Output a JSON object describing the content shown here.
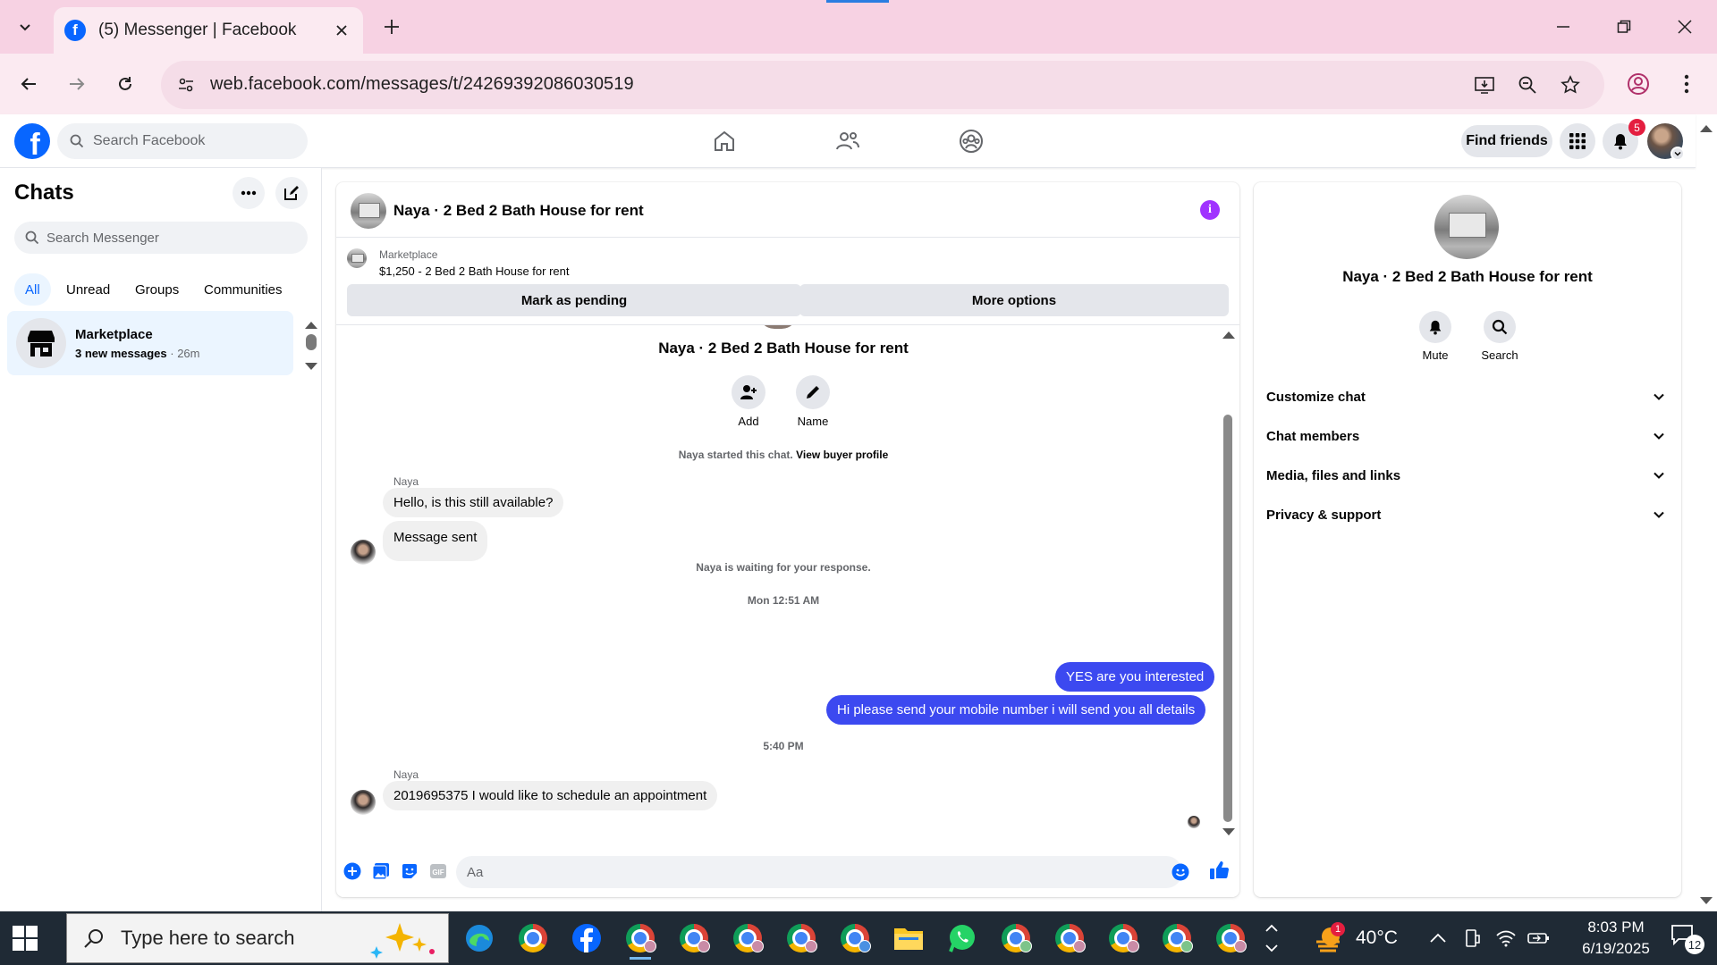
{
  "browser": {
    "tab_title": "(5) Messenger | Facebook",
    "favicon_letter": "f",
    "url": "web.facebook.com/messages/t/24269392086030519"
  },
  "fb_header": {
    "logo_letter": "f",
    "search_placeholder": "Search Facebook",
    "find_friends_label": "Find friends",
    "notification_count": "5"
  },
  "chats": {
    "title": "Chats",
    "search_placeholder": "Search Messenger",
    "filters": [
      "All",
      "Unread",
      "Groups",
      "Communities"
    ],
    "active_filter": "All",
    "items": [
      {
        "name": "Marketplace",
        "preview": "3 new messages",
        "time": "· 26m"
      }
    ]
  },
  "conversation": {
    "title": "Naya · 2 Bed 2 Bath House for rent",
    "marketplace": {
      "label": "Marketplace",
      "listing": "$1,250 - 2 Bed 2 Bath House for rent",
      "pending_button": "Mark as pending",
      "more_button": "More options"
    },
    "intro": {
      "title": "Naya · 2 Bed 2 Bath House for rent",
      "actions": [
        "Add",
        "Name"
      ]
    },
    "messages": {
      "started_text": "Naya started this chat.",
      "view_profile": "View buyer profile",
      "sender_1": "Naya",
      "in_1": "Hello, is this still available?",
      "in_2": "Message sent",
      "waiting": "Naya is waiting for your response.",
      "time_1": "Mon 12:51 AM",
      "out_1": "YES are you interested",
      "out_2": "Hi please send your mobile number  i will send you all details",
      "time_2": "5:40 PM",
      "sender_2": "Naya",
      "in_3": "2019695375 I would like to schedule an appointment"
    },
    "composer_placeholder": "Aa"
  },
  "info_panel": {
    "title": "Naya · 2 Bed 2 Bath House for rent",
    "actions": [
      "Mute",
      "Search"
    ],
    "sections": [
      "Customize chat",
      "Chat members",
      "Media, files and links",
      "Privacy & support"
    ]
  },
  "taskbar": {
    "search_placeholder": "Type here to search",
    "weather": "40°C",
    "weather_badge": "1",
    "time": "8:03 PM",
    "date": "6/19/2025",
    "notification_count": "12"
  },
  "colors": {
    "fb_blue": "#0866ff",
    "outgoing_bubble": "#3c49f0",
    "tabbar_pink": "#f7d2e3",
    "taskbar": "#1f2a35"
  }
}
